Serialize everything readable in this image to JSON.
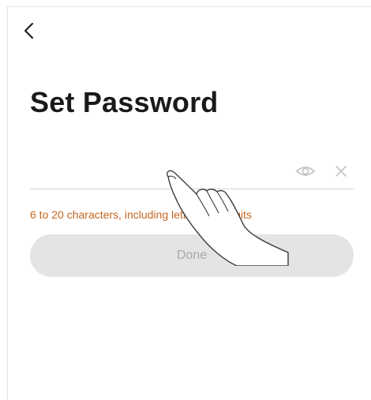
{
  "header": {
    "back_icon": "chevron-left-icon"
  },
  "page": {
    "title": "Set Password"
  },
  "password_field": {
    "value": "",
    "placeholder": "",
    "visibility_icon": "eye-icon",
    "clear_icon": "close-icon"
  },
  "hint": {
    "text": "6 to 20 characters, including letters and digits",
    "color": "#c4661f"
  },
  "actions": {
    "done_label": "Done",
    "done_enabled": false,
    "done_background": "#e4e4e4"
  },
  "overlay": {
    "icon": "hand-pointer-icon"
  }
}
